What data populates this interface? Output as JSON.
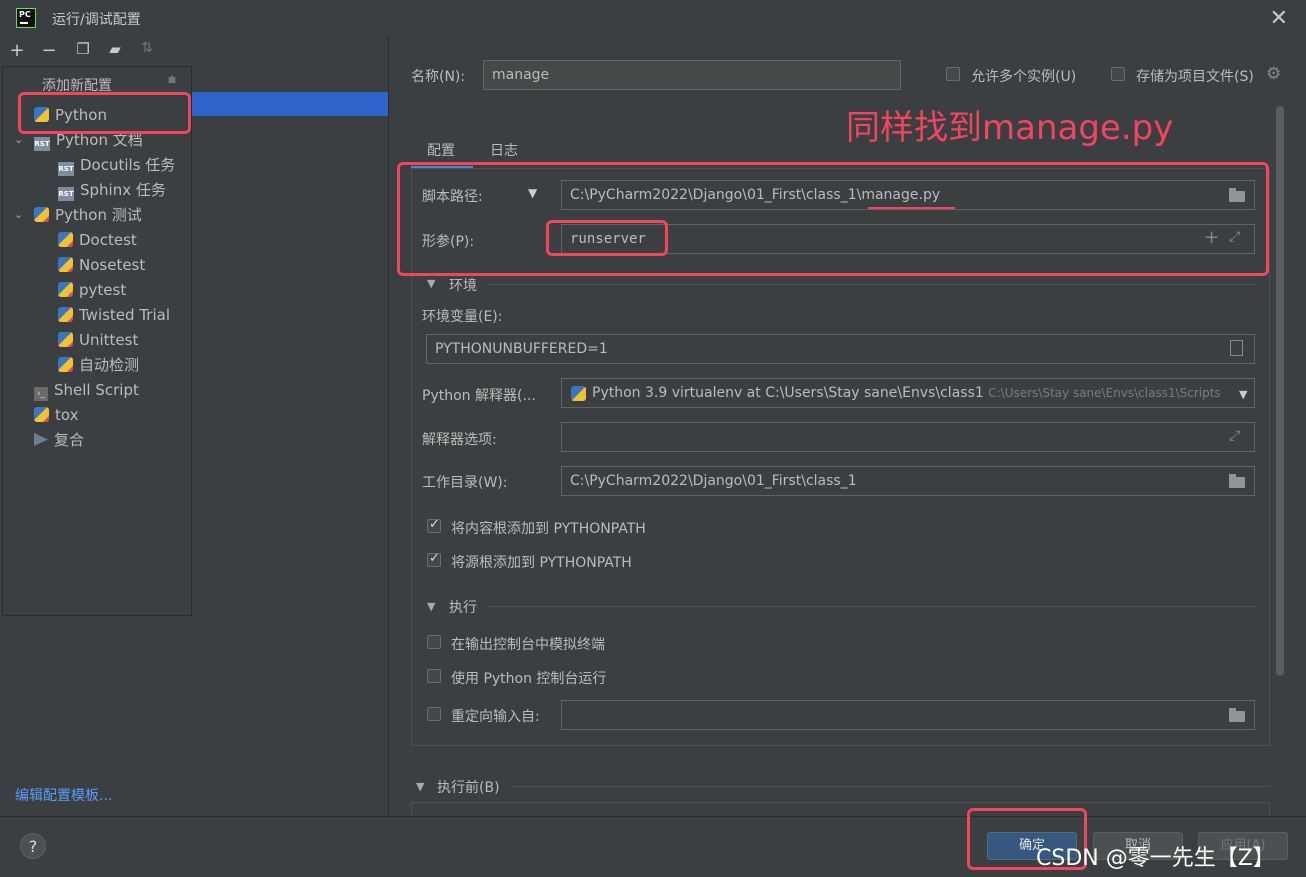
{
  "window": {
    "title": "运行/调试配置"
  },
  "popup": {
    "header": "添加新配置"
  },
  "tree": {
    "items": [
      {
        "label": "Python"
      },
      {
        "label": "Python 文档"
      },
      {
        "label": "Docutils 任务"
      },
      {
        "label": "Sphinx 任务"
      },
      {
        "label": "Python 测试"
      },
      {
        "label": "Doctest"
      },
      {
        "label": "Nosetest"
      },
      {
        "label": "pytest"
      },
      {
        "label": "Twisted Trial"
      },
      {
        "label": "Unittest"
      },
      {
        "label": "自动检测"
      },
      {
        "label": "Shell Script"
      },
      {
        "label": "tox"
      },
      {
        "label": "复合"
      }
    ],
    "edit_templates_link": "编辑配置模板..."
  },
  "form": {
    "name_label": "名称(N):",
    "name_value": "manage",
    "allow_parallel_label": "允许多个实例(U)",
    "store_as_project_label": "存储为项目文件(S)",
    "tabs": [
      {
        "label": "配置"
      },
      {
        "label": "日志"
      }
    ],
    "script_path_label": "脚本路径:",
    "script_path_value": "C:\\PyCharm2022\\Django\\01_First\\class_1\\manage.py",
    "params_label": "形参(P):",
    "params_value": "runserver",
    "env_section": "环境",
    "env_vars_label": "环境变量(E):",
    "env_vars_value": "PYTHONUNBUFFERED=1",
    "interpreter_label": "Python 解释器(...",
    "interpreter_value": "Python 3.9 virtualenv at C:\\Users\\Stay sane\\Envs\\class1",
    "interpreter_hint": "C:\\Users\\Stay sane\\Envs\\class1\\Scripts",
    "interp_options_label": "解释器选项:",
    "workdir_label": "工作目录(W):",
    "workdir_value": "C:\\PyCharm2022\\Django\\01_First\\class_1",
    "add_content_roots_label": "将内容根添加到 PYTHONPATH",
    "add_source_roots_label": "将源根添加到 PYTHONPATH",
    "exec_section": "执行",
    "emulate_terminal_label": "在输出控制台中模拟终端",
    "run_with_console_label": "使用 Python 控制台运行",
    "redirect_input_label": "重定向输入自:",
    "before_launch_section": "执行前(B)"
  },
  "buttons": {
    "ok": "确定",
    "cancel": "取消",
    "apply": "应用(A)"
  },
  "annotation": "同样找到manage.py",
  "watermark": "CSDN @零一先生【Z】",
  "colors": {
    "annotation_red": "#f0445f",
    "selection_blue": "#2f65ca",
    "background": "#3c3f41"
  }
}
